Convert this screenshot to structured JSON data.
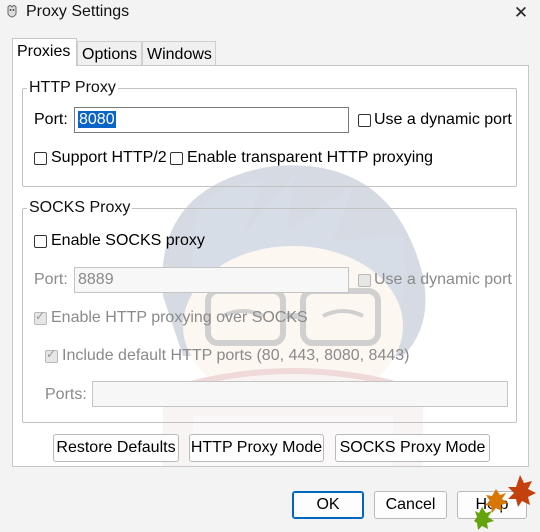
{
  "window": {
    "title": "Proxy Settings",
    "close_glyph": "✕"
  },
  "tabs": [
    {
      "label": "Proxies",
      "active": true
    },
    {
      "label": "Options",
      "active": false
    },
    {
      "label": "Windows",
      "active": false
    }
  ],
  "http_proxy": {
    "legend": "HTTP Proxy",
    "port_label": "Port:",
    "port_value": "8080",
    "dynamic_port_label": "Use a dynamic port",
    "dynamic_port_checked": false,
    "support_http2_label": "Support HTTP/2",
    "support_http2_checked": false,
    "transparent_label": "Enable transparent HTTP proxying",
    "transparent_checked": false
  },
  "socks_proxy": {
    "legend": "SOCKS Proxy",
    "enable_label": "Enable SOCKS proxy",
    "enable_checked": false,
    "port_label": "Port:",
    "port_value": "8889",
    "dynamic_port_label": "Use a dynamic port",
    "http_over_socks_label": "Enable HTTP proxying over SOCKS",
    "http_over_socks_checked": true,
    "include_ports_label": "Include default HTTP ports (80, 443, 8080, 8443)",
    "include_ports_checked": true,
    "ports_label": "Ports:",
    "ports_value": ""
  },
  "mode_buttons": {
    "restore": "Restore Defaults",
    "http_mode": "HTTP Proxy Mode",
    "socks_mode": "SOCKS Proxy Mode"
  },
  "dialog_buttons": {
    "ok": "OK",
    "cancel": "Cancel",
    "help": "Help"
  },
  "colors": {
    "accent": "#0067c0",
    "selection": "#0a64c8",
    "background": "#f3f3f3"
  }
}
